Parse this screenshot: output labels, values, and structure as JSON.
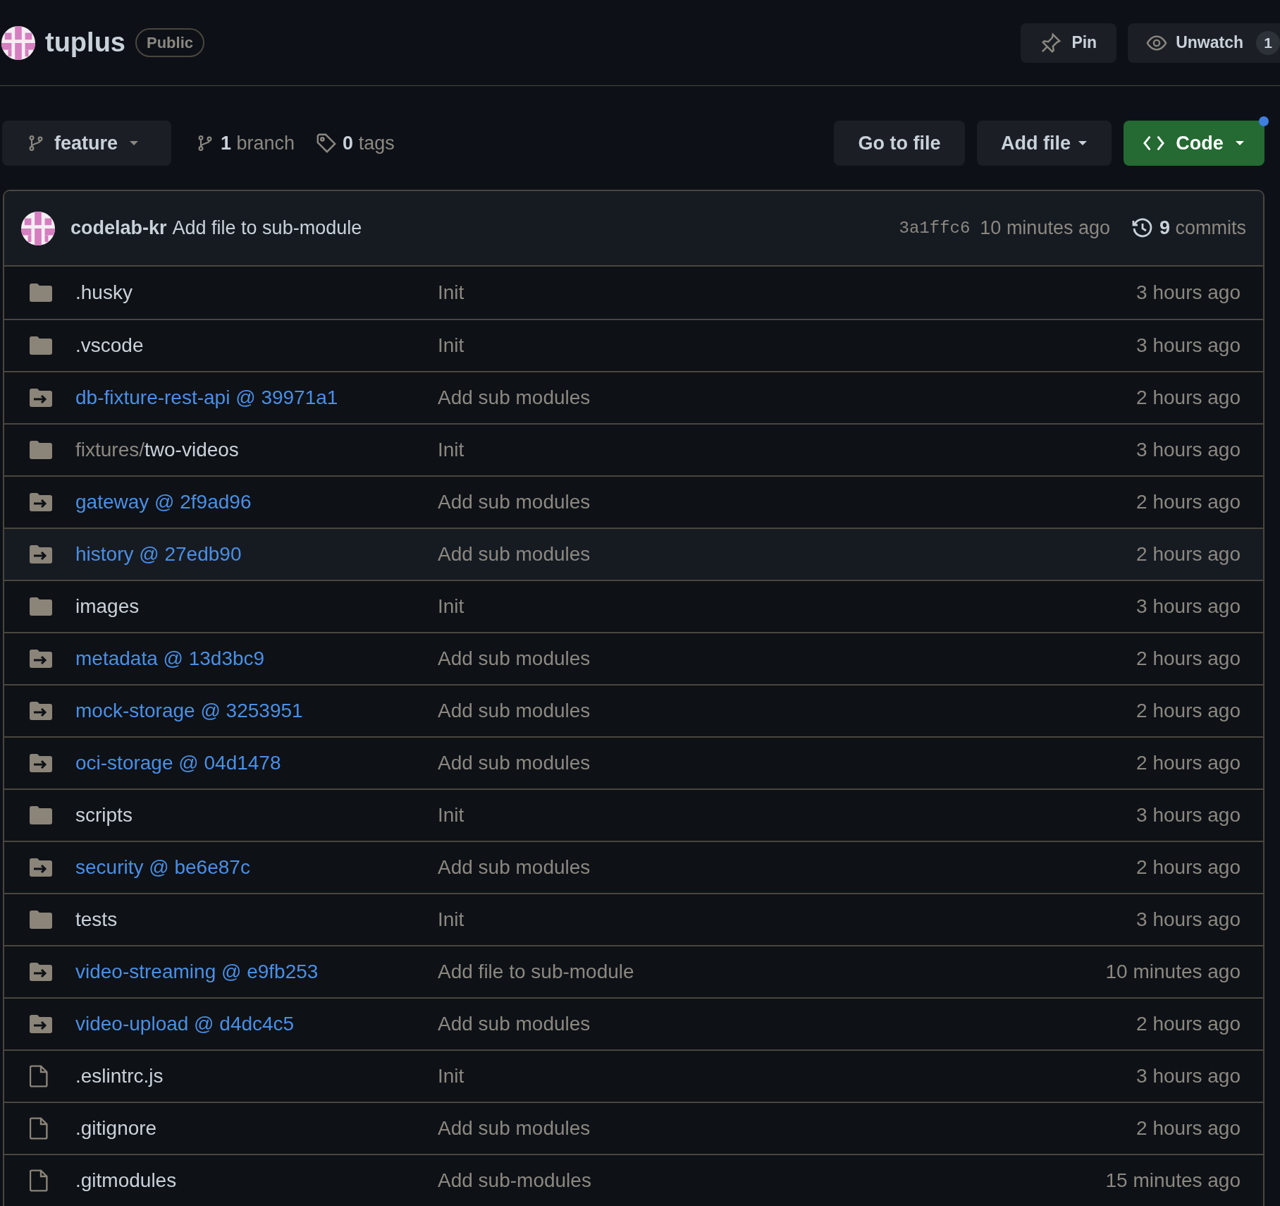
{
  "repo": {
    "name": "tuplus",
    "visibility": "Public"
  },
  "header_actions": {
    "pin": "Pin",
    "unwatch": "Unwatch",
    "watchers": "1"
  },
  "toolbar": {
    "branch": "feature",
    "branch_count": "1",
    "branch_label": "branch",
    "tag_count": "0",
    "tag_label": "tags",
    "go_to_file": "Go to file",
    "add_file": "Add file",
    "code": "Code",
    "code_notification": true
  },
  "latest_commit": {
    "author": "codelab-kr",
    "message": "Add file to sub-module",
    "sha": "3a1ffc6",
    "time": "10 minutes ago",
    "commit_count": "9",
    "commit_label": "commits"
  },
  "files": [
    {
      "kind": "folder",
      "name": ".husky",
      "message": "Init",
      "time": "3 hours ago",
      "highlighted": false
    },
    {
      "kind": "folder",
      "name": ".vscode",
      "message": "Init",
      "time": "3 hours ago",
      "highlighted": false
    },
    {
      "kind": "submodule",
      "name": "db-fixture-rest-api @ 39971a1",
      "message": "Add sub modules",
      "time": "2 hours ago",
      "highlighted": false
    },
    {
      "kind": "folder",
      "path_prefix": "fixtures/",
      "name": "two-videos",
      "message": "Init",
      "time": "3 hours ago",
      "highlighted": false
    },
    {
      "kind": "submodule",
      "name": "gateway @ 2f9ad96",
      "message": "Add sub modules",
      "time": "2 hours ago",
      "highlighted": false
    },
    {
      "kind": "submodule",
      "name": "history @ 27edb90",
      "message": "Add sub modules",
      "time": "2 hours ago",
      "highlighted": true
    },
    {
      "kind": "folder",
      "name": "images",
      "message": "Init",
      "time": "3 hours ago",
      "highlighted": false
    },
    {
      "kind": "submodule",
      "name": "metadata @ 13d3bc9",
      "message": "Add sub modules",
      "time": "2 hours ago",
      "highlighted": false
    },
    {
      "kind": "submodule",
      "name": "mock-storage @ 3253951",
      "message": "Add sub modules",
      "time": "2 hours ago",
      "highlighted": false
    },
    {
      "kind": "submodule",
      "name": "oci-storage @ 04d1478",
      "message": "Add sub modules",
      "time": "2 hours ago",
      "highlighted": false
    },
    {
      "kind": "folder",
      "name": "scripts",
      "message": "Init",
      "time": "3 hours ago",
      "highlighted": false
    },
    {
      "kind": "submodule",
      "name": "security @ be6e87c",
      "message": "Add sub modules",
      "time": "2 hours ago",
      "highlighted": false
    },
    {
      "kind": "folder",
      "name": "tests",
      "message": "Init",
      "time": "3 hours ago",
      "highlighted": false
    },
    {
      "kind": "submodule",
      "name": "video-streaming @ e9fb253",
      "message": "Add file to sub-module",
      "time": "10 minutes ago",
      "highlighted": false
    },
    {
      "kind": "submodule",
      "name": "video-upload @ d4dc4c5",
      "message": "Add sub modules",
      "time": "2 hours ago",
      "highlighted": false
    },
    {
      "kind": "file",
      "name": ".eslintrc.js",
      "message": "Init",
      "time": "3 hours ago",
      "highlighted": false
    },
    {
      "kind": "file",
      "name": ".gitignore",
      "message": "Add sub modules",
      "time": "2 hours ago",
      "highlighted": false
    },
    {
      "kind": "file",
      "name": ".gitmodules",
      "message": "Add sub-modules",
      "time": "15 minutes ago",
      "highlighted": false
    }
  ]
}
